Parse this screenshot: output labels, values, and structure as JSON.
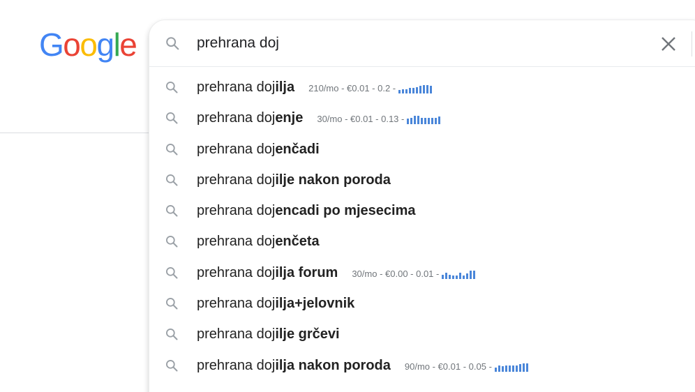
{
  "logo": {
    "letters": [
      "G",
      "o",
      "o",
      "g",
      "l",
      "e"
    ],
    "colors": [
      "#4285F4",
      "#EA4335",
      "#FBBC05",
      "#4285F4",
      "#34A853",
      "#EA4335"
    ]
  },
  "search": {
    "value": "prehrana doj",
    "clear_icon": "close-icon",
    "search_icon": "search-icon"
  },
  "suggestions": [
    {
      "prefix": "prehrana doj",
      "completion": "ilja",
      "meta": "210/mo - €0.01 - 0.2 -",
      "trend": [
        3,
        4,
        4,
        5,
        5,
        6,
        7,
        8,
        8,
        7
      ]
    },
    {
      "prefix": "prehrana doj",
      "completion": "enje",
      "meta": "30/mo - €0.01 - 0.13 -",
      "trend": [
        5,
        6,
        8,
        8,
        6,
        6,
        6,
        6,
        6,
        7
      ]
    },
    {
      "prefix": "prehrana doj",
      "completion": "enčadi",
      "meta": ""
    },
    {
      "prefix": "prehrana doj",
      "completion": "ilje nakon poroda",
      "meta": ""
    },
    {
      "prefix": "prehrana doj",
      "completion": "encadi po mjesecima",
      "meta": ""
    },
    {
      "prefix": "prehrana doj",
      "completion": "enčeta",
      "meta": ""
    },
    {
      "prefix": "prehrana doj",
      "completion": "ilja forum",
      "meta": "30/mo - €0.00 - 0.01 -",
      "trend": [
        4,
        6,
        4,
        3,
        3,
        6,
        3,
        5,
        8,
        8
      ]
    },
    {
      "prefix": "prehrana doj",
      "completion": "ilja+jelovnik",
      "meta": ""
    },
    {
      "prefix": "prehrana doj",
      "completion": "ilje grčevi",
      "meta": ""
    },
    {
      "prefix": "prehrana doj",
      "completion": "ilja nakon poroda",
      "meta": "90/mo - €0.01 - 0.05 -",
      "trend": [
        4,
        6,
        5,
        6,
        6,
        6,
        6,
        7,
        8,
        8
      ]
    }
  ],
  "colors": {
    "trend_bar": "#4a86d9",
    "icon_gray": "#9aa0a6"
  }
}
